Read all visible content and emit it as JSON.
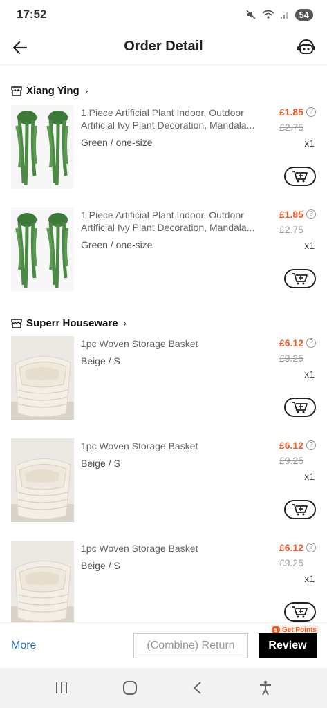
{
  "status": {
    "time": "17:52",
    "battery": "54"
  },
  "header": {
    "title": "Order Detail"
  },
  "stores": [
    {
      "name": "Xiang Ying"
    },
    {
      "name": "Superr Houseware"
    }
  ],
  "items": [
    {
      "name": "1 Piece Artificial Plant Indoor, Outdoor Artificial Ivy Plant Decoration, Mandala...",
      "variant": "Green / one-size",
      "price": "£1.85",
      "original_price": "£2.75",
      "qty": "x1"
    },
    {
      "name": "1 Piece Artificial Plant Indoor, Outdoor Artificial Ivy Plant Decoration, Mandala...",
      "variant": "Green / one-size",
      "price": "£1.85",
      "original_price": "£2.75",
      "qty": "x1"
    },
    {
      "name": "1pc Woven Storage Basket",
      "variant": "Beige / S",
      "price": "£6.12",
      "original_price": "£9.25",
      "qty": "x1"
    },
    {
      "name": "1pc Woven Storage Basket",
      "variant": "Beige / S",
      "price": "£6.12",
      "original_price": "£9.25",
      "qty": "x1"
    },
    {
      "name": "1pc Woven Storage Basket",
      "variant": "Beige / S",
      "price": "£6.12",
      "original_price": "£9.25",
      "qty": "x1"
    }
  ],
  "info_icon_glyph": "?",
  "bottom": {
    "more_label": "More",
    "return_label": "(Combine) Return",
    "review_label": "Review",
    "points_label": "Get Points"
  },
  "colors": {
    "price": "#f05a28",
    "link": "#2f6fbd",
    "review_bg": "#000000"
  }
}
